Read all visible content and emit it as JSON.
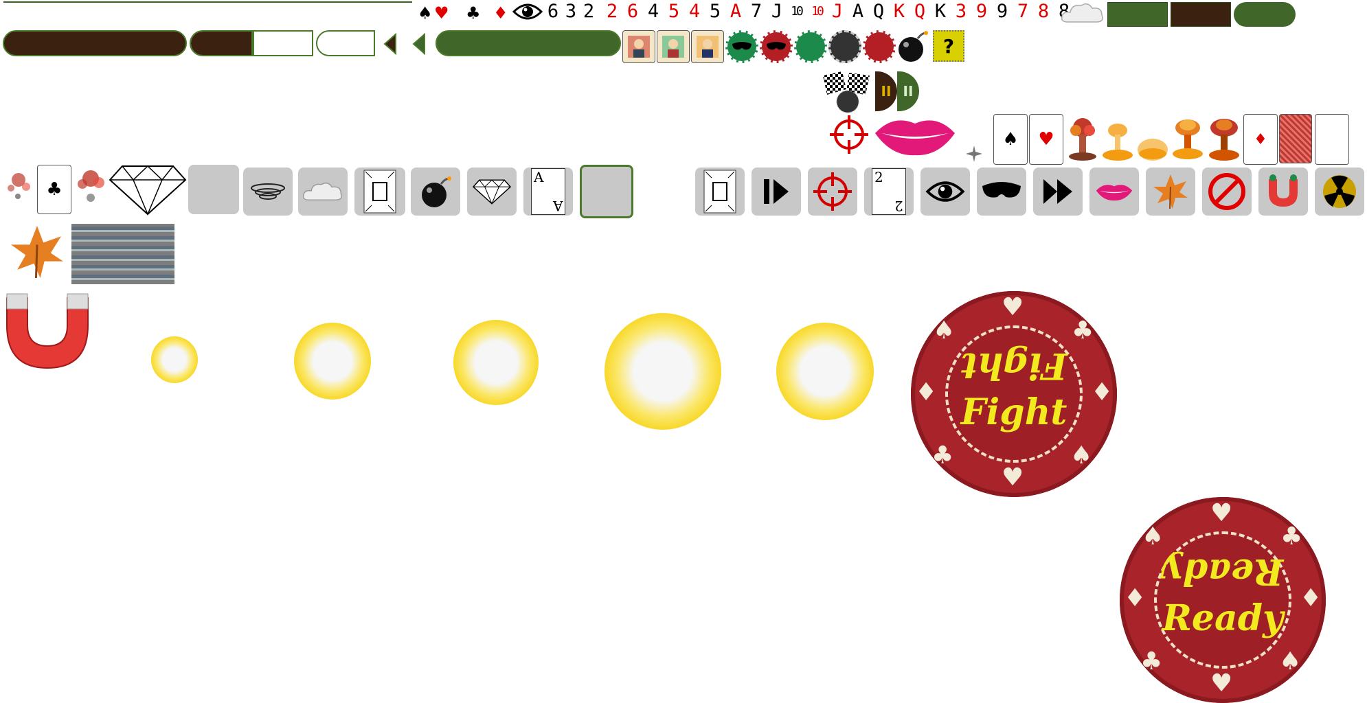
{
  "sprite_sheet": {
    "glyph_row": [
      {
        "t": "♠",
        "c": "blk"
      },
      {
        "t": "♥",
        "c": "red"
      },
      {
        "t": "♣",
        "c": "blk"
      },
      {
        "t": "♦",
        "c": "red"
      },
      {
        "t": "6",
        "c": "blk"
      },
      {
        "t": "3",
        "c": "blk"
      },
      {
        "t": "2",
        "c": "blk"
      },
      {
        "t": "2",
        "c": "red"
      },
      {
        "t": "6",
        "c": "red"
      },
      {
        "t": "4",
        "c": "blk"
      },
      {
        "t": "5",
        "c": "red"
      },
      {
        "t": "4",
        "c": "red"
      },
      {
        "t": "5",
        "c": "blk"
      },
      {
        "t": "A",
        "c": "red"
      },
      {
        "t": "7",
        "c": "blk"
      },
      {
        "t": "J",
        "c": "blk"
      },
      {
        "t": "10",
        "c": "blk"
      },
      {
        "t": "10",
        "c": "red"
      },
      {
        "t": "J",
        "c": "red"
      },
      {
        "t": "A",
        "c": "blk"
      },
      {
        "t": "Q",
        "c": "blk"
      },
      {
        "t": "K",
        "c": "red"
      },
      {
        "t": "Q",
        "c": "red"
      },
      {
        "t": "K",
        "c": "blk"
      },
      {
        "t": "3",
        "c": "red"
      },
      {
        "t": "9",
        "c": "red"
      },
      {
        "t": "9",
        "c": "blk"
      },
      {
        "t": "7",
        "c": "red"
      },
      {
        "t": "8",
        "c": "red"
      },
      {
        "t": "8",
        "c": "blk"
      }
    ],
    "question_mark": "?",
    "pause_glyph": "II",
    "card_tile_letter": "A",
    "card_tile_number": "2",
    "small_cards": [
      "♠",
      "♥",
      "♦"
    ],
    "left_cards": [
      "♣"
    ],
    "fight_chip": {
      "word": "Fight"
    },
    "ready_chip": {
      "word": "Ready"
    },
    "colors": {
      "dark_bar": "#3b2210",
      "green_bar": "#41662a",
      "chip_red": "#a8232a",
      "chip_text": "#f2ea1e",
      "tile_gray": "#c8c8c8"
    },
    "icons": [
      "eye-icon",
      "cloud-icon",
      "crosshair-icon",
      "mask-icon",
      "lips-icon",
      "leaf-icon",
      "bomb-icon",
      "diamond-icon",
      "magnet-icon",
      "no-entry-icon",
      "radioactive-icon",
      "checkered-flag-icon",
      "explosion-icon"
    ]
  }
}
